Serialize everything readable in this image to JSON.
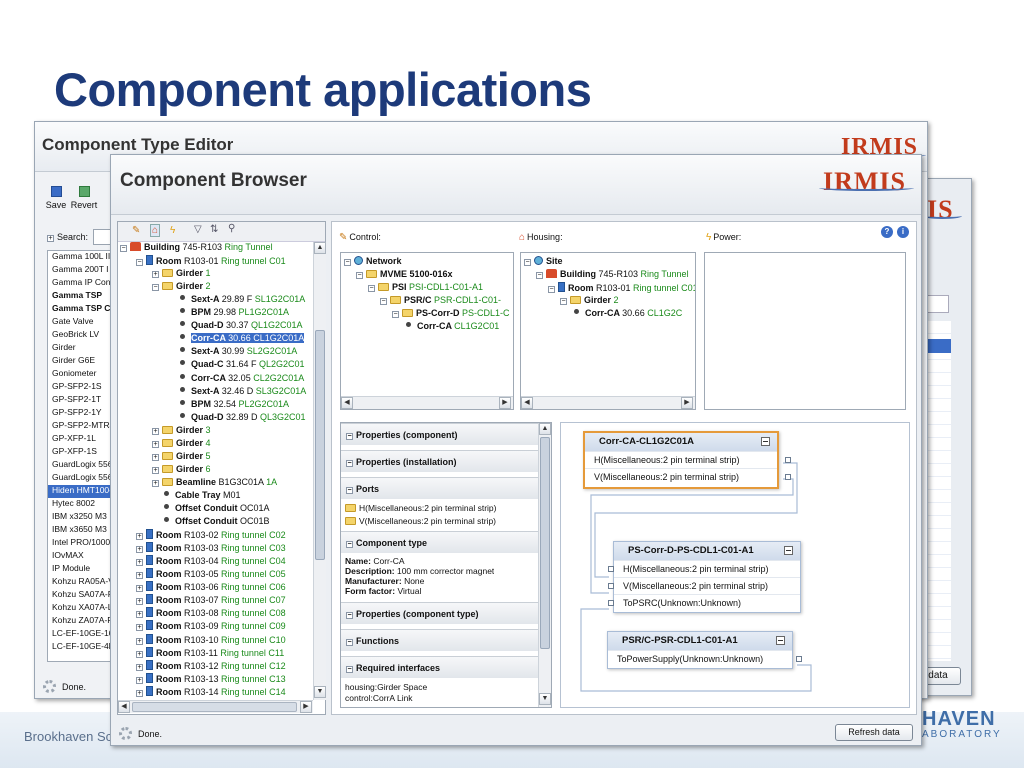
{
  "slide": {
    "title": "Component applications",
    "footer_left": "Brookhaven Sc",
    "footer_logo_top": "HAVEN",
    "footer_logo_bottom": "ABORATORY"
  },
  "editor": {
    "title": "Component Type Editor",
    "logo": "IRMIS",
    "save_label": "Save",
    "revert_label": "Revert",
    "search_label": "Search:",
    "status": "Done.",
    "list": [
      "Gamma 100L II",
      "Gamma 200T I",
      "Gamma IP Con",
      "Gamma TSP",
      "Gamma TSP C",
      "Gate Valve",
      "GeoBrick LV",
      "Girder",
      "Girder G6E",
      "Goniometer",
      "GP-SFP2-1S",
      "GP-SFP2-1T",
      "GP-SFP2-1Y",
      "GP-SFP2-MTRJ",
      "GP-XFP-1L",
      "GP-XFP-1S",
      "GuardLogix 556",
      "GuardLogix 556",
      "Hiden HMT100-",
      "Hytec 8002",
      "IBM x3250 M3",
      "IBM x3650 M3",
      "Intel PRO/1000",
      "IOvMAX",
      "IP Module",
      "Kohzu RA05A-V",
      "Kohzu SA07A-R",
      "Kohzu XA07A-L",
      "Kohzu ZA07A-R",
      "LC-EF-10GE-16",
      "LC-EF-10GE-4P"
    ]
  },
  "third": {
    "logo": "IS",
    "btn": "data"
  },
  "browser": {
    "title": "Component Browser",
    "logo": "IRMIS",
    "status": "Done.",
    "refresh_label": "Refresh data",
    "tree": [
      {
        "ind": 0,
        "ctl": "-",
        "icon": "bld",
        "n": "Building",
        "v": "745-R103",
        "g": "Ring Tunnel"
      },
      {
        "ind": 1,
        "ctl": "-",
        "icon": "room",
        "n": "Room",
        "v": "R103-01",
        "g": "Ring tunnel C01"
      },
      {
        "ind": 2,
        "ctl": "+",
        "icon": "fold",
        "n": "Girder",
        "v": "",
        "g": "1"
      },
      {
        "ind": 2,
        "ctl": "-",
        "icon": "fold",
        "n": "Girder",
        "v": "",
        "g": "2"
      },
      {
        "ind": 3,
        "ctl": "",
        "icon": "dot",
        "n": "Sext-A",
        "v": "29.89 F",
        "g": "SL1G2C01A"
      },
      {
        "ind": 3,
        "ctl": "",
        "icon": "dot",
        "n": "BPM",
        "v": "29.98",
        "g": "PL1G2C01A"
      },
      {
        "ind": 3,
        "ctl": "",
        "icon": "dot",
        "n": "Quad-D",
        "v": "30.37",
        "g": "QL1G2C01A"
      },
      {
        "ind": 3,
        "ctl": "",
        "icon": "dot",
        "n": "Corr-CA",
        "v": "30.66",
        "g": "CL1G2C01A",
        "sel": true
      },
      {
        "ind": 3,
        "ctl": "",
        "icon": "dot",
        "n": "Sext-A",
        "v": "30.99",
        "g": "SL2G2C01A"
      },
      {
        "ind": 3,
        "ctl": "",
        "icon": "dot",
        "n": "Quad-C",
        "v": "31.64 F",
        "g": "QL2G2C01"
      },
      {
        "ind": 3,
        "ctl": "",
        "icon": "dot",
        "n": "Corr-CA",
        "v": "32.05",
        "g": "CL2G2C01A"
      },
      {
        "ind": 3,
        "ctl": "",
        "icon": "dot",
        "n": "Sext-A",
        "v": "32.46 D",
        "g": "SL3G2C01A"
      },
      {
        "ind": 3,
        "ctl": "",
        "icon": "dot",
        "n": "BPM",
        "v": "32.54",
        "g": "PL2G2C01A"
      },
      {
        "ind": 3,
        "ctl": "",
        "icon": "dot",
        "n": "Quad-D",
        "v": "32.89 D",
        "g": "QL3G2C01"
      },
      {
        "ind": 2,
        "ctl": "+",
        "icon": "fold",
        "n": "Girder",
        "v": "",
        "g": "3"
      },
      {
        "ind": 2,
        "ctl": "+",
        "icon": "fold",
        "n": "Girder",
        "v": "",
        "g": "4"
      },
      {
        "ind": 2,
        "ctl": "+",
        "icon": "fold",
        "n": "Girder",
        "v": "",
        "g": "5"
      },
      {
        "ind": 2,
        "ctl": "+",
        "icon": "fold",
        "n": "Girder",
        "v": "",
        "g": "6"
      },
      {
        "ind": 2,
        "ctl": "+",
        "icon": "fold",
        "n": "Beamline",
        "v": "B1G3C01A",
        "g": "1A"
      },
      {
        "ind": 2,
        "ctl": "",
        "icon": "dot",
        "n": "Cable Tray",
        "v": "M01",
        "g": ""
      },
      {
        "ind": 2,
        "ctl": "",
        "icon": "dot",
        "n": "Offset Conduit",
        "v": "OC01A",
        "g": ""
      },
      {
        "ind": 2,
        "ctl": "",
        "icon": "dot",
        "n": "Offset Conduit",
        "v": "OC01B",
        "g": ""
      },
      {
        "ind": 1,
        "ctl": "+",
        "icon": "room",
        "n": "Room",
        "v": "R103-02",
        "g": "Ring tunnel C02"
      },
      {
        "ind": 1,
        "ctl": "+",
        "icon": "room",
        "n": "Room",
        "v": "R103-03",
        "g": "Ring tunnel C03"
      },
      {
        "ind": 1,
        "ctl": "+",
        "icon": "room",
        "n": "Room",
        "v": "R103-04",
        "g": "Ring tunnel C04"
      },
      {
        "ind": 1,
        "ctl": "+",
        "icon": "room",
        "n": "Room",
        "v": "R103-05",
        "g": "Ring tunnel C05"
      },
      {
        "ind": 1,
        "ctl": "+",
        "icon": "room",
        "n": "Room",
        "v": "R103-06",
        "g": "Ring tunnel C06"
      },
      {
        "ind": 1,
        "ctl": "+",
        "icon": "room",
        "n": "Room",
        "v": "R103-07",
        "g": "Ring tunnel C07"
      },
      {
        "ind": 1,
        "ctl": "+",
        "icon": "room",
        "n": "Room",
        "v": "R103-08",
        "g": "Ring tunnel C08"
      },
      {
        "ind": 1,
        "ctl": "+",
        "icon": "room",
        "n": "Room",
        "v": "R103-09",
        "g": "Ring tunnel C09"
      },
      {
        "ind": 1,
        "ctl": "+",
        "icon": "room",
        "n": "Room",
        "v": "R103-10",
        "g": "Ring tunnel C10"
      },
      {
        "ind": 1,
        "ctl": "+",
        "icon": "room",
        "n": "Room",
        "v": "R103-11",
        "g": "Ring tunnel C11"
      },
      {
        "ind": 1,
        "ctl": "+",
        "icon": "room",
        "n": "Room",
        "v": "R103-12",
        "g": "Ring tunnel C12"
      },
      {
        "ind": 1,
        "ctl": "+",
        "icon": "room",
        "n": "Room",
        "v": "R103-13",
        "g": "Ring tunnel C13"
      },
      {
        "ind": 1,
        "ctl": "+",
        "icon": "room",
        "n": "Room",
        "v": "R103-14",
        "g": "Ring tunnel C14"
      }
    ],
    "control": {
      "label": "Control:",
      "rows": [
        {
          "ind": 0,
          "n": "Network",
          "v": "",
          "g": ""
        },
        {
          "ind": 1,
          "n": "MVME 5100-016x",
          "v": "",
          "g": ""
        },
        {
          "ind": 2,
          "n": "PSI",
          "v": "",
          "g": "PSI-CDL1-C01-A1"
        },
        {
          "ind": 3,
          "n": "PSR/C",
          "v": "",
          "g": "PSR-CDL1-C01-"
        },
        {
          "ind": 4,
          "n": "PS-Corr-D",
          "v": "",
          "g": "PS-CDL1-C"
        },
        {
          "ind": 5,
          "n": "Corr-CA",
          "v": "",
          "g": "CL1G2C01"
        }
      ]
    },
    "housing": {
      "label": "Housing:",
      "rows": [
        {
          "ind": 0,
          "n": "Site",
          "v": "",
          "g": ""
        },
        {
          "ind": 1,
          "n": "Building",
          "v": "745-R103",
          "g": "Ring Tunnel"
        },
        {
          "ind": 2,
          "n": "Room",
          "v": "R103-01",
          "g": "Ring tunnel C01"
        },
        {
          "ind": 3,
          "n": "Girder",
          "v": "",
          "g": "2"
        },
        {
          "ind": 4,
          "n": "Corr-CA",
          "v": "30.66",
          "g": "CL1G2C"
        }
      ]
    },
    "power": {
      "label": "Power:"
    },
    "props": {
      "s1": "Properties (component)",
      "s2": "Properties (installation)",
      "s3": "Ports",
      "port1": "H(Miscellaneous:2 pin terminal strip)",
      "port2": "V(Miscellaneous:2 pin terminal strip)",
      "s4": "Component type",
      "name_k": "Name:",
      "name_v": "Corr-CA",
      "desc_k": "Description:",
      "desc_v": "100 mm corrector magnet",
      "man_k": "Manufacturer:",
      "man_v": "None",
      "ff_k": "Form factor:",
      "ff_v": "Virtual",
      "s5": "Properties (component type)",
      "s6": "Functions",
      "s7": "Required interfaces",
      "ri1": "housing:Girder Space",
      "ri2": "control:CorrA Link"
    },
    "diagram": {
      "b1": {
        "title": "Corr-CA-CL1G2C01A",
        "p1": "H(Miscellaneous:2 pin terminal strip)",
        "p2": "V(Miscellaneous:2 pin terminal strip)"
      },
      "b2": {
        "title": "PS-Corr-D-PS-CDL1-C01-A1",
        "p1": "H(Miscellaneous:2 pin terminal strip)",
        "p2": "V(Miscellaneous:2 pin terminal strip)",
        "p3": "ToPSRC(Unknown:Unknown)"
      },
      "b3": {
        "title": "PSR/C-PSR-CDL1-C01-A1",
        "p1": "ToPowerSupply(Unknown:Unknown)"
      }
    }
  }
}
